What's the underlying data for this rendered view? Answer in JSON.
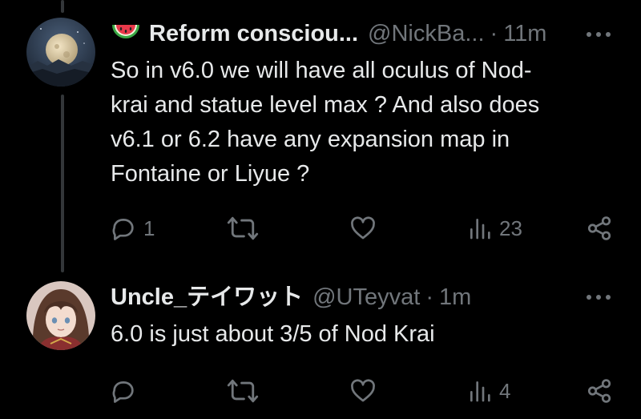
{
  "posts": [
    {
      "display_name": "Reform consciou...",
      "handle": "@NickBa...",
      "separator": "·",
      "time": "11m",
      "text": "So in v6.0 we will have all oculus of Nod-\nkrai and statue level max ? And also does\nv6.1 or 6.2 have any expansion map in\nFontaine or Liyue ?",
      "replies": "1",
      "reposts": "",
      "likes": "",
      "views": "23",
      "name_icon": "watermelon-emoji"
    },
    {
      "display_name": "Uncle_テイワット",
      "handle": "@UTeyvat",
      "separator": "·",
      "time": "1m",
      "text": "6.0 is just about 3/5 of Nod Krai",
      "replies": "",
      "reposts": "",
      "likes": "",
      "views": "4"
    }
  ],
  "colors": {
    "background": "#000000",
    "text_primary": "#e7e9ea",
    "text_secondary": "#71767b",
    "thread_line": "#333639"
  }
}
